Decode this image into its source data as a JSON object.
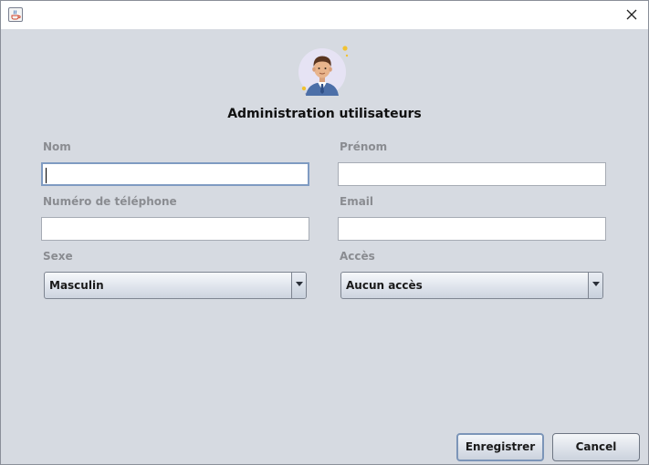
{
  "window": {
    "icon": "java-cup-icon",
    "close_icon": "close-icon"
  },
  "header": {
    "avatar_icon": "user-avatar-icon",
    "title": "Administration utilisateurs"
  },
  "form": {
    "nom": {
      "label": "Nom",
      "value": ""
    },
    "prenom": {
      "label": "Prénom",
      "value": ""
    },
    "telephone": {
      "label": "Numéro de téléphone",
      "value": ""
    },
    "email": {
      "label": "Email",
      "value": ""
    },
    "sexe": {
      "label": "Sexe",
      "selected": "Masculin"
    },
    "acces": {
      "label": "Accès",
      "selected": "Aucun accès"
    }
  },
  "buttons": {
    "save_label": "Enregistrer",
    "cancel_label": "Cancel"
  },
  "colors": {
    "background": "#d6dae1",
    "label": "#8a8c91",
    "focus_border": "#7f9bc2"
  }
}
